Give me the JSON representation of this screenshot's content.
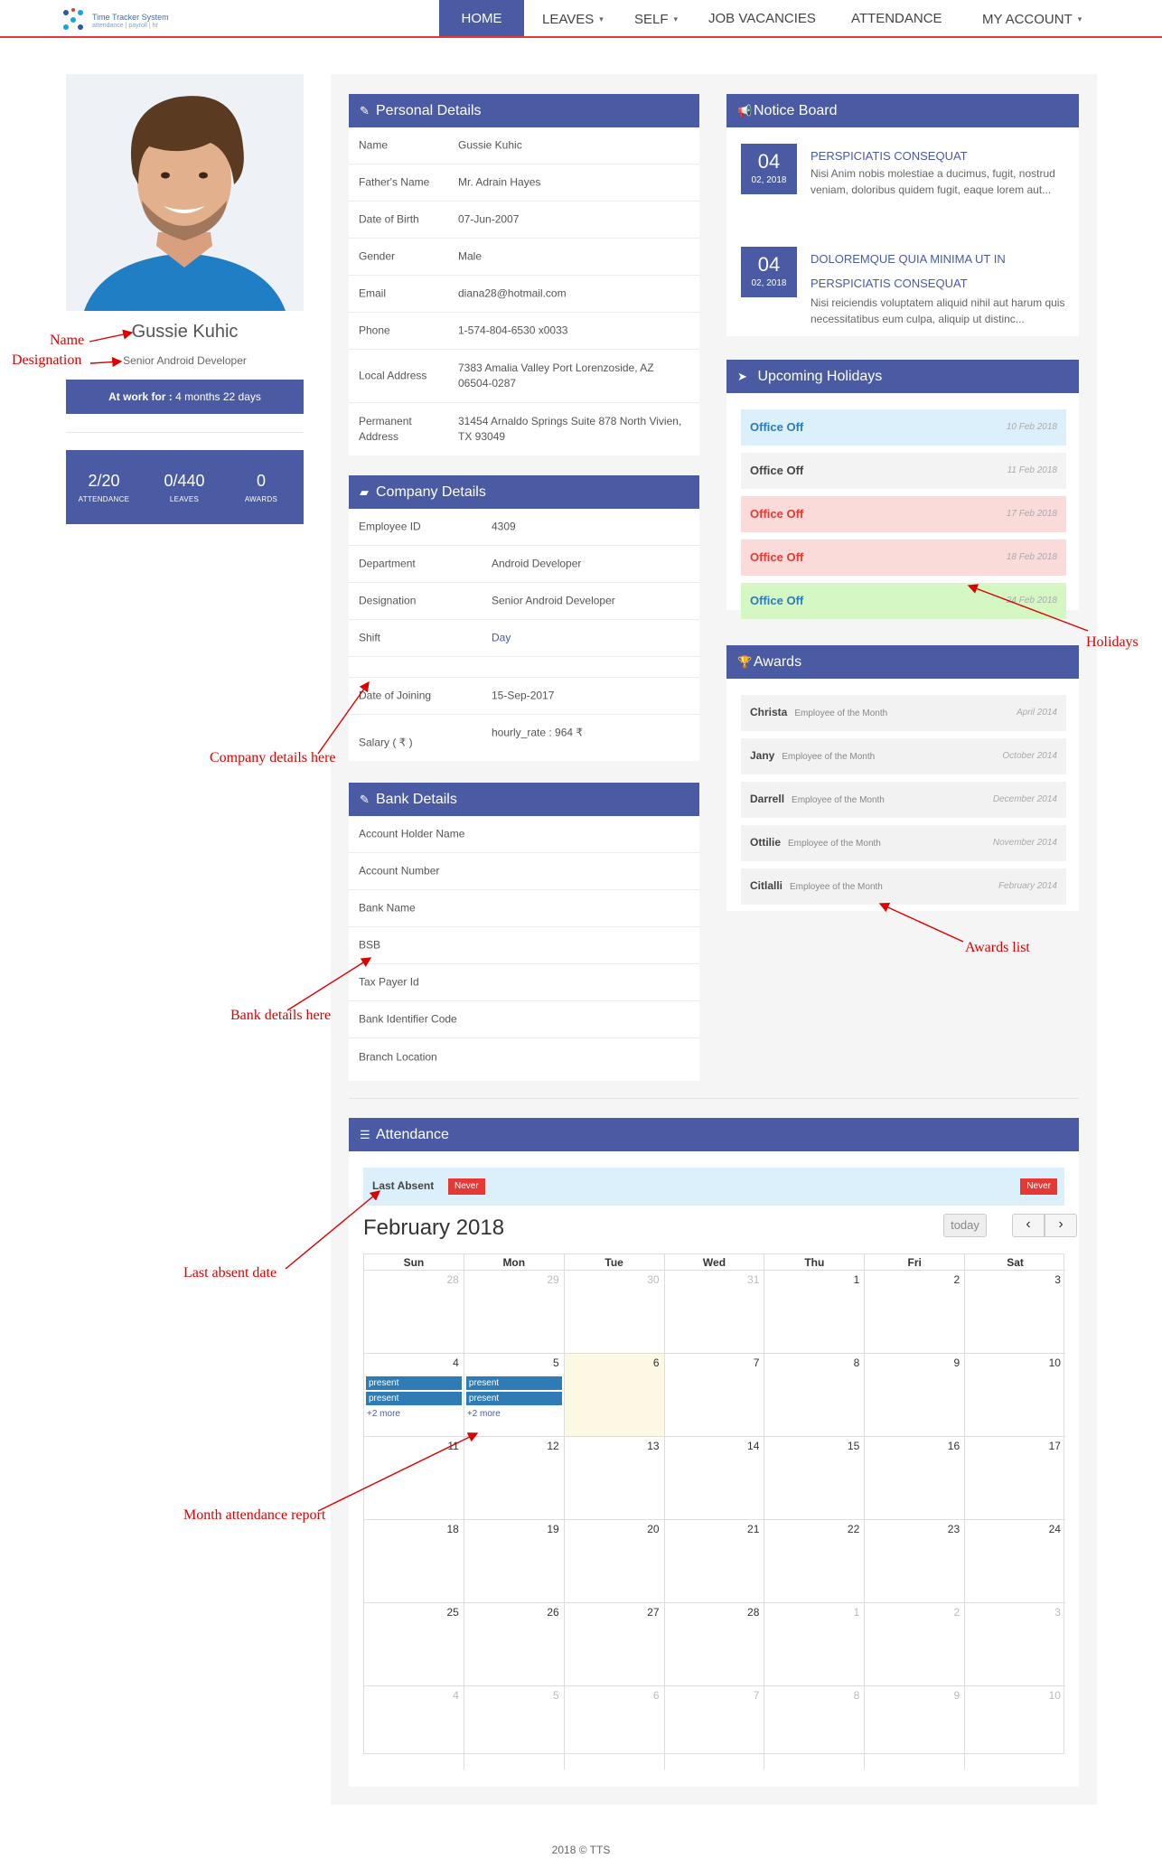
{
  "app": {
    "logo_title": "Time Tracker System",
    "logo_subtitle": "attendance | payroll | hr"
  },
  "nav": {
    "home": "HOME",
    "leaves": "LEAVES",
    "self": "SELF",
    "job_vacancies": "JOB VACANCIES",
    "attendance": "ATTENDANCE",
    "my_account": "MY ACCOUNT"
  },
  "profile": {
    "name": "Gussie Kuhic",
    "designation": "Senior Android Developer",
    "at_work_label": "At work for :",
    "at_work_value": "4 months 22 days",
    "stats": [
      {
        "value": "2/20",
        "label": "ATTENDANCE"
      },
      {
        "value": "0/440",
        "label": "LEAVES"
      },
      {
        "value": "0",
        "label": "AWARDS"
      }
    ]
  },
  "personal": {
    "title": "Personal Details",
    "rows": [
      {
        "k": "Name",
        "v": "Gussie Kuhic"
      },
      {
        "k": "Father's Name",
        "v": "Mr. Adrain Hayes"
      },
      {
        "k": "Date of Birth",
        "v": "07-Jun-2007"
      },
      {
        "k": "Gender",
        "v": "Male"
      },
      {
        "k": "Email",
        "v": "diana28@hotmail.com"
      },
      {
        "k": "Phone",
        "v": "1-574-804-6530 x0033"
      },
      {
        "k": "Local Address",
        "v": "7383 Amalia Valley Port Lorenzoside, AZ 06504-0287"
      },
      {
        "k": "Permanent Address",
        "v": "31454 Arnaldo Springs Suite 878 North Vivien, TX 93049"
      }
    ]
  },
  "company": {
    "title": "Company Details",
    "rows": [
      {
        "k": "Employee ID",
        "v": "4309"
      },
      {
        "k": "Department",
        "v": "Android Developer"
      },
      {
        "k": "Designation",
        "v": "Senior Android Developer"
      },
      {
        "k": "Shift",
        "v": "Day"
      },
      {
        "k": "",
        "v": ""
      },
      {
        "k": "Date of Joining",
        "v": "15-Sep-2017"
      },
      {
        "k": "Salary ( ₹ )",
        "v": "hourly_rate : 964 ₹"
      }
    ]
  },
  "bank": {
    "title": "Bank Details",
    "rows": [
      {
        "k": "Account Holder Name"
      },
      {
        "k": "Account Number"
      },
      {
        "k": "Bank Name"
      },
      {
        "k": "BSB"
      },
      {
        "k": "Tax Payer Id"
      },
      {
        "k": "Bank Identifier Code"
      },
      {
        "k": "Branch Location"
      }
    ]
  },
  "notice_board": {
    "title": "Notice Board",
    "items": [
      {
        "day": "04",
        "month": "02, 2018",
        "title": "PERSPICIATIS CONSEQUAT",
        "text": "Nisi Anim nobis molestiae a ducimus, fugit, nostrud veniam, doloribus quidem fugit, eaque lorem aut..."
      },
      {
        "day": "04",
        "month": "02, 2018",
        "title": "DOLOREMQUE QUIA MINIMA UT IN PERSPICIATIS CONSEQUAT",
        "text": "Nisi reiciendis voluptatem aliquid nihil aut harum quis necessitatibus eum culpa, aliquip ut distinc..."
      }
    ]
  },
  "holidays": {
    "title": "Upcoming Holidays",
    "items": [
      {
        "label": "Office Off",
        "date": "10 Feb 2018",
        "bg": "#dcf0fc",
        "color": "#2e7bb5"
      },
      {
        "label": "Office Off",
        "date": "11 Feb 2018",
        "bg": "#f3f3f3",
        "color": "#444444"
      },
      {
        "label": "Office Off",
        "date": "17 Feb 2018",
        "bg": "#fbdada",
        "color": "#e53935"
      },
      {
        "label": "Office Off",
        "date": "18 Feb 2018",
        "bg": "#fbdada",
        "color": "#e53935"
      },
      {
        "label": "Office Off",
        "date": "24 Feb 2018",
        "bg": "#d4f7c4",
        "color": "#2e7bb5"
      }
    ]
  },
  "awards": {
    "title": "Awards",
    "items": [
      {
        "name": "Christa",
        "award": "Employee of the Month",
        "date": "April 2014"
      },
      {
        "name": "Jany",
        "award": "Employee of the Month",
        "date": "October 2014"
      },
      {
        "name": "Darrell",
        "award": "Employee of the Month",
        "date": "December 2014"
      },
      {
        "name": "Ottilie",
        "award": "Employee of the Month",
        "date": "November 2014"
      },
      {
        "name": "Citlalli",
        "award": "Employee of the Month",
        "date": "February 2014"
      }
    ]
  },
  "attendance": {
    "title": "Attendance",
    "last_absent_label": "Last Absent",
    "last_absent_badge": "Never",
    "last_absent_badge_right": "Never",
    "month_title": "February 2018",
    "today_label": "today",
    "prev_label": "‹",
    "next_label": "›",
    "weekdays": [
      "Sun",
      "Mon",
      "Tue",
      "Wed",
      "Thu",
      "Fri",
      "Sat"
    ],
    "weeks": [
      [
        {
          "d": "28",
          "o": true
        },
        {
          "d": "29",
          "o": true
        },
        {
          "d": "30",
          "o": true
        },
        {
          "d": "31",
          "o": true
        },
        {
          "d": "1"
        },
        {
          "d": "2"
        },
        {
          "d": "3"
        }
      ],
      [
        {
          "d": "4",
          "ev": [
            "present",
            "present"
          ],
          "more": "+2 more"
        },
        {
          "d": "5",
          "ev": [
            "present",
            "present"
          ],
          "more": "+2 more"
        },
        {
          "d": "6",
          "today": true
        },
        {
          "d": "7"
        },
        {
          "d": "8"
        },
        {
          "d": "9"
        },
        {
          "d": "10"
        }
      ],
      [
        {
          "d": "11"
        },
        {
          "d": "12"
        },
        {
          "d": "13"
        },
        {
          "d": "14"
        },
        {
          "d": "15"
        },
        {
          "d": "16"
        },
        {
          "d": "17"
        }
      ],
      [
        {
          "d": "18"
        },
        {
          "d": "19"
        },
        {
          "d": "20"
        },
        {
          "d": "21"
        },
        {
          "d": "22"
        },
        {
          "d": "23"
        },
        {
          "d": "24"
        }
      ],
      [
        {
          "d": "25"
        },
        {
          "d": "26"
        },
        {
          "d": "27"
        },
        {
          "d": "28"
        },
        {
          "d": "1",
          "o": true
        },
        {
          "d": "2",
          "o": true
        },
        {
          "d": "3",
          "o": true
        }
      ],
      [
        {
          "d": "4",
          "o": true
        },
        {
          "d": "5",
          "o": true
        },
        {
          "d": "6",
          "o": true
        },
        {
          "d": "7",
          "o": true
        },
        {
          "d": "8",
          "o": true
        },
        {
          "d": "9",
          "o": true
        },
        {
          "d": "10",
          "o": true
        }
      ]
    ]
  },
  "footer": "2018 © TTS",
  "annotations": {
    "name": "Name",
    "designation": "Designation",
    "company": "Company details here",
    "bank": "Bank details here",
    "last_absent": "Last absent date",
    "month_report": "Month attendance report",
    "holidays": "Holidays",
    "awards": "Awards list"
  },
  "colors": {
    "primary": "#4a5aa3",
    "accent_red": "#e53935",
    "event_blue": "#2e7bb5"
  }
}
